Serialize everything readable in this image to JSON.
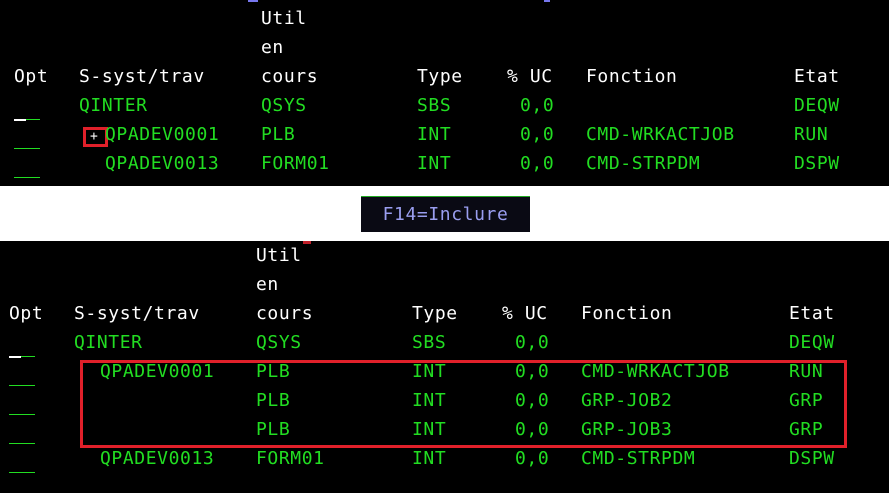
{
  "columns": {
    "opt": "Opt",
    "subsys_line": "S-syst/trav",
    "user_line1": "Util",
    "user_line2": "en",
    "user_line3": "cours",
    "type": "Type",
    "cpu": "% UC",
    "function": "Fonction",
    "status": "Etat"
  },
  "expand_marker": "+",
  "top_rows": [
    {
      "subsys": "QINTER",
      "user": "QSYS",
      "type": "SBS",
      "cpu": "0,0",
      "function": "",
      "status": "DEQW"
    },
    {
      "subsys": "QPADEV0001",
      "user": "PLB",
      "type": "INT",
      "cpu": "0,0",
      "function": "CMD-WRKACTJOB",
      "status": "RUN"
    },
    {
      "subsys": "QPADEV0013",
      "user": "FORM01",
      "type": "INT",
      "cpu": "0,0",
      "function": "CMD-STRPDM",
      "status": "DSPW"
    }
  ],
  "function_key": "F14=Inclure",
  "bottom_rows": [
    {
      "subsys": "QINTER",
      "user": "QSYS",
      "type": "SBS",
      "cpu": "0,0",
      "function": "",
      "status": "DEQW"
    },
    {
      "subsys": "QPADEV0001",
      "user": "PLB",
      "type": "INT",
      "cpu": "0,0",
      "function": "CMD-WRKACTJOB",
      "status": "RUN"
    },
    {
      "subsys": "",
      "user": "PLB",
      "type": "INT",
      "cpu": "0,0",
      "function": "GRP-JOB2",
      "status": "GRP"
    },
    {
      "subsys": "",
      "user": "PLB",
      "type": "INT",
      "cpu": "0,0",
      "function": "GRP-JOB3",
      "status": "GRP"
    },
    {
      "subsys": "QPADEV0013",
      "user": "FORM01",
      "type": "INT",
      "cpu": "0,0",
      "function": "CMD-STRPDM",
      "status": "DSPW"
    }
  ],
  "colors": {
    "background": "#000000",
    "text_green": "#22dd22",
    "text_white": "#ffffff",
    "highlight_red": "#e0202a",
    "function_key_text": "#9a9ef0"
  }
}
